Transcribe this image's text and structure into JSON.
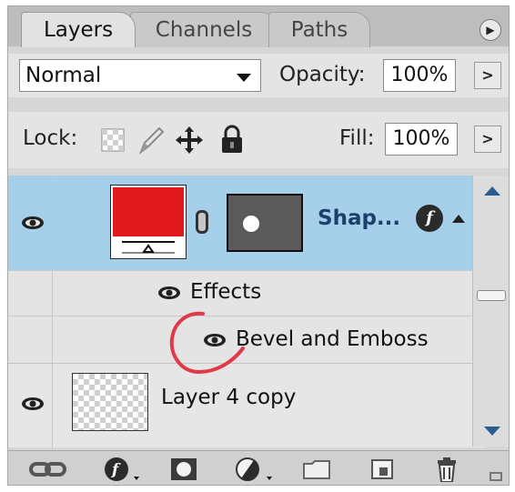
{
  "tabs": [
    {
      "label": "Layers"
    },
    {
      "label": "Channels"
    },
    {
      "label": "Paths"
    }
  ],
  "blend_mode": "Normal",
  "opacity": {
    "label": "Opacity:",
    "value": "100%"
  },
  "lock": {
    "label": "Lock:"
  },
  "fill": {
    "label": "Fill:",
    "value": "100%"
  },
  "layers": [
    {
      "name": "Shap...",
      "color": "#e0191c"
    },
    {
      "name": "Layer 4 copy"
    }
  ],
  "effects": {
    "label": "Effects",
    "items": [
      "Bevel and Emboss"
    ]
  },
  "colors": {
    "selected_row": "#a6cfea",
    "annotation": "#e03a4a"
  }
}
